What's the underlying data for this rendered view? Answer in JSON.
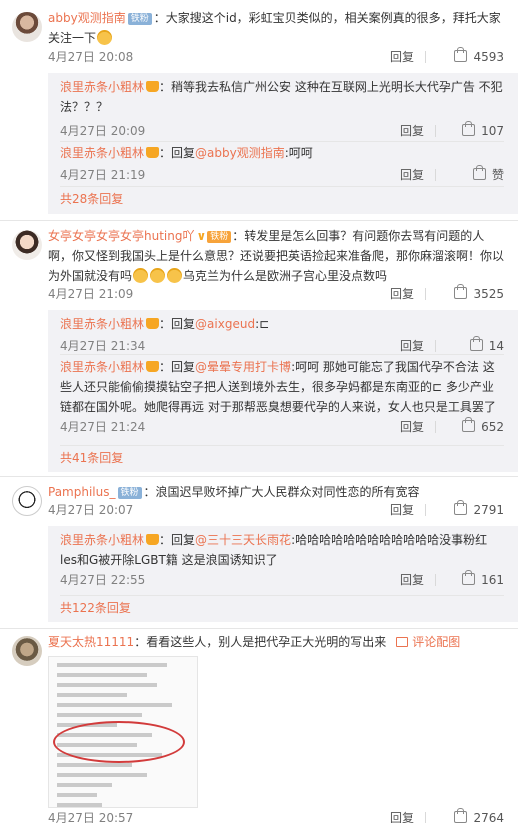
{
  "labels": {
    "reply": "回复",
    "like_word": "赞",
    "colon": "："
  },
  "c1": {
    "user": "abby观测指南",
    "badge": "铁粉",
    "text": "大家搜这个id，彩虹宝贝类似的，相关案例真的很多，拜托大家关注一下",
    "time": "4月27日 20:08",
    "likes": "4593",
    "replies": [
      {
        "user": "浪里赤条小粗林",
        "text": "稍等我去私信广州公安 这种在互联网上光明长大代孕广告 不犯法？？？",
        "time": "4月27日 20:09",
        "likes": "107"
      },
      {
        "user": "浪里赤条小粗林",
        "prefix": "回复",
        "mention": "@abby观测指南",
        "text": ":呵呵",
        "time": "4月27日 21:19",
        "likes": "赞"
      }
    ],
    "more": "共28条回复"
  },
  "c2": {
    "user": "女亭女亭女亭女亭huting吖",
    "badge": "铁粉",
    "text": "转发里是怎么回事？有问题你去骂有问题的人啊，你又怪到我国头上是什么意思？还说要把英语捡起来准备爬，那你麻溜滚啊！你以为外国就没有吗",
    "text2": "乌克兰为什么是欧洲子宫心里没点数吗",
    "time": "4月27日 21:09",
    "likes": "3525",
    "replies": [
      {
        "user": "浪里赤条小粗林",
        "prefix": "回复",
        "mention": "@aixgeud",
        "text": ":⊏",
        "time": "4月27日 21:34",
        "likes": "14"
      },
      {
        "user": "浪里赤条小粗林",
        "prefix": "回复",
        "mention": "@晕晕专用打卡博",
        "text": ":呵呵 那她可能忘了我国代孕不合法 这些人还只能偷偷摸摸钻空子把人送到境外去生，很多孕妈都是东南亚的⊏ 多少产业链都在国外呢。她爬得再远 对于那帮恶臭想要代孕的人来说，女人也只是工具罢了",
        "time": "4月27日 21:24",
        "likes": "652"
      }
    ],
    "more": "共41条回复"
  },
  "c3": {
    "user": "Pamphilus_",
    "badge": "铁粉",
    "text": "浪国迟早败坏掉广大人民群众对同性恋的所有宽容",
    "time": "4月27日 20:07",
    "likes": "2791",
    "replies": [
      {
        "user": "浪里赤条小粗林",
        "prefix": "回复",
        "mention": "@三十三天长雨花",
        "text": ":哈哈哈哈哈哈哈哈哈哈哈哈没事粉红les和G被开除LGBT籍 这是浪国诱知识了",
        "time": "4月27日 22:55",
        "likes": "161"
      }
    ],
    "more": "共122条回复"
  },
  "c4": {
    "user": "夏天太热11111",
    "text": "看看这些人，别人是把代孕正大光明的写出来",
    "pic_link": "评论配图",
    "time": "4月27日 20:57",
    "likes": "2764"
  }
}
